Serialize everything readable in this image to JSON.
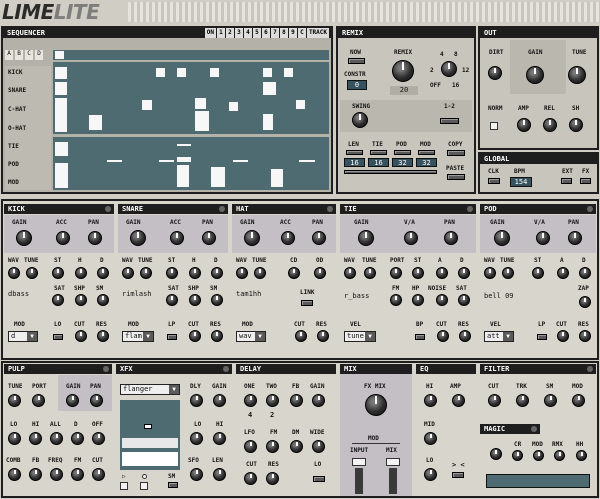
{
  "logo": {
    "part1": "LIME",
    "part2": "LITE"
  },
  "sequencer": {
    "title": "SEQUENCER",
    "on_label": "ON",
    "track_label": "TRACK",
    "pattern_letters": [
      "A",
      "B",
      "C",
      "D"
    ],
    "track_buttons": [
      "1",
      "2",
      "3",
      "4",
      "5",
      "6",
      "7",
      "8",
      "9",
      "C"
    ],
    "rows": [
      "KICK",
      "SNARE",
      "C-HAT",
      "O-HAT",
      "TIE",
      "POD",
      "MOD"
    ]
  },
  "remix": {
    "title": "REMIX",
    "now_label": "NOW",
    "remix_label": "REMIX",
    "remix_value": "20",
    "sel_labels": [
      "4",
      "8",
      "2",
      "12",
      "OFF",
      "16"
    ],
    "constr_label": "CONSTR",
    "constr_value": "0",
    "swing_label": "SWING",
    "ratio_label": "1-2",
    "len_label": "LEN",
    "tie_label": "TIE",
    "pod_label": "POD",
    "mod_label": "MOD",
    "values": [
      "16",
      "16",
      "32",
      "32"
    ],
    "copy_label": "COPY",
    "paste_label": "PASTE"
  },
  "out": {
    "title": "OUT",
    "dirt": "DIRT",
    "gain": "GAIN",
    "tune": "TUNE",
    "norm": "NORM",
    "amp": "AMP",
    "rel": "REL",
    "sh": "SH"
  },
  "global": {
    "title": "GLOBAL",
    "clk": "CLK",
    "bpm": "BPM",
    "bpm_value": "154",
    "ext": "EXT",
    "fx": "FX"
  },
  "kick": {
    "title": "KICK",
    "gain": "GAIN",
    "acc": "ACC",
    "pan": "PAN",
    "wav": "WAV",
    "tune": "TUNE",
    "st": "ST",
    "h": "H",
    "d": "D",
    "preset": "dbass",
    "sat": "SAT",
    "shp": "SHP",
    "sm": "SM",
    "mod_label": "MOD",
    "mod_value": "d",
    "lo": "LO",
    "cut": "CUT",
    "res": "RES"
  },
  "snare": {
    "title": "SNARE",
    "gain": "GAIN",
    "acc": "ACC",
    "pan": "PAN",
    "wav": "WAV",
    "tune": "TUNE",
    "st": "ST",
    "h": "H",
    "d": "D",
    "preset": "rimlash",
    "sat": "SAT",
    "shp": "SHP",
    "sm": "SM",
    "mod_label": "MOD",
    "mod_value": "flam",
    "lp": "LP",
    "cut": "CUT",
    "res": "RES"
  },
  "hat": {
    "title": "HAT",
    "gain": "GAIN",
    "acc": "ACC",
    "pan": "PAN",
    "wav": "WAV",
    "tune": "TUNE",
    "cd": "CD",
    "od": "OD",
    "preset": "tam1hh",
    "link": "LINK",
    "mod_label": "MOD",
    "mod_value": "wav",
    "cut": "CUT",
    "res": "RES"
  },
  "tie": {
    "title": "TIE",
    "gain": "GAIN",
    "vsa": "V/A",
    "pan": "PAN",
    "wav": "WAV",
    "tune": "TUNE",
    "port": "PORT",
    "st": "ST",
    "a": "A",
    "d": "D",
    "preset": "r_bass",
    "fm": "FM",
    "hp": "HP",
    "noise": "NOISE",
    "sat": "SAT",
    "vel_label": "VEL",
    "vel_value": "tune",
    "bp": "BP",
    "cut": "CUT",
    "res": "RES"
  },
  "pod": {
    "title": "POD",
    "gain": "GAIN",
    "vsa": "V/A",
    "pan": "PAN",
    "wav": "WAV",
    "tune": "TUNE",
    "st": "ST",
    "a": "A",
    "d": "D",
    "preset": "bell 09",
    "zap": "ZAP",
    "vel_label": "VEL",
    "vel_value": "att",
    "lp": "LP",
    "cut": "CUT",
    "res": "RES"
  },
  "pulp": {
    "title": "PULP",
    "tune": "TUNE",
    "port": "PORT",
    "gain": "GAIN",
    "pan": "PAN",
    "lo": "LO",
    "hi": "HI",
    "all": "ALL",
    "d": "D",
    "off": "OFF",
    "comb": "COMB",
    "fb": "FB",
    "freq": "FREQ",
    "fm": "FM",
    "cut": "CUT"
  },
  "xfx": {
    "title": "XFX",
    "select": "flanger",
    "dly": "DLY",
    "gain": "GAIN",
    "lo": "LO",
    "hi": "HI",
    "sfo": "SFO",
    "len": "LEN",
    "sm": "SM"
  },
  "delay": {
    "title": "DELAY",
    "one": "ONE",
    "two": "TWO",
    "fb": "FB",
    "gain": "GAIN",
    "v1": "4",
    "v2": "2",
    "lfo": "LFO",
    "fm": "FM",
    "dm": "DM",
    "wide": "WIDE",
    "cut": "CUT",
    "res": "RES",
    "lo": "LO"
  },
  "mix": {
    "title": "MIX",
    "fx_mix": "FX MIX",
    "mod": "MOD",
    "input": "INPUT",
    "mix": "MIX"
  },
  "eq": {
    "title": "EQ",
    "hi": "HI",
    "amp": "AMP",
    "mid": "MID",
    "lo": "LO",
    "arrow": "> <"
  },
  "filter": {
    "title": "FILTER",
    "cut": "CUT",
    "trk": "TRK",
    "sm": "SM",
    "mod": "MOD"
  },
  "magic": {
    "title": "MAGIC",
    "cr": "CR",
    "mod": "MOD",
    "rmx": "RMX",
    "hh": "HH"
  }
}
